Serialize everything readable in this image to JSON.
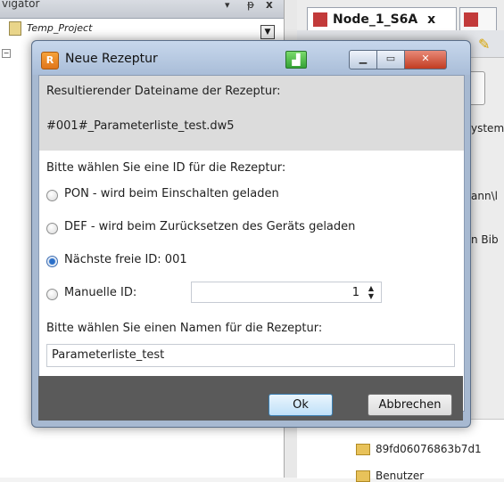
{
  "navigator": {
    "title": "vigator",
    "pin_glyph": "▾",
    "pin2_glyph": "ᵽ",
    "close_glyph": "x",
    "root_item": "Temp_Project"
  },
  "editor": {
    "tab_label": "Node_1_S6A",
    "tab_close": "x",
    "right_texts": {
      "ystem": "ystem",
      "path": "ann\\l",
      "bib": "n Bib",
      "hash": "89fd06076863b7d1",
      "benutzer": "Benutzer"
    }
  },
  "dialog": {
    "title": "Neue Rezeptur",
    "result_label": "Resultierender Dateiname der Rezeptur:",
    "result_filename": "#001#_Parameterliste_test.dw5",
    "id_prompt": "Bitte wählen Sie eine ID für die Rezeptur:",
    "options": [
      {
        "label": "PON - wird beim Einschalten geladen",
        "checked": false
      },
      {
        "label": "DEF - wird beim Zurücksetzen des Geräts geladen",
        "checked": false
      },
      {
        "label": "Nächste freie ID: 001",
        "checked": true
      },
      {
        "label": "Manuelle ID:",
        "checked": false
      }
    ],
    "manual_id_value": "1",
    "name_prompt": "Bitte wählen Sie einen Namen für die Rezeptur:",
    "name_value": "Parameterliste_test",
    "ok_label": "Ok",
    "cancel_label": "Abbrechen"
  },
  "icons": {
    "app": "recipe-app-icon",
    "green": "screen-icon",
    "minimize": "minimize-icon",
    "maximize": "maximize-icon",
    "close": "close-icon"
  },
  "colors": {
    "title_bg": "#a9bdd8",
    "close_button": "#c23c22",
    "footer_bg": "#5a5a5a",
    "info_band": "#dcdcdc"
  }
}
